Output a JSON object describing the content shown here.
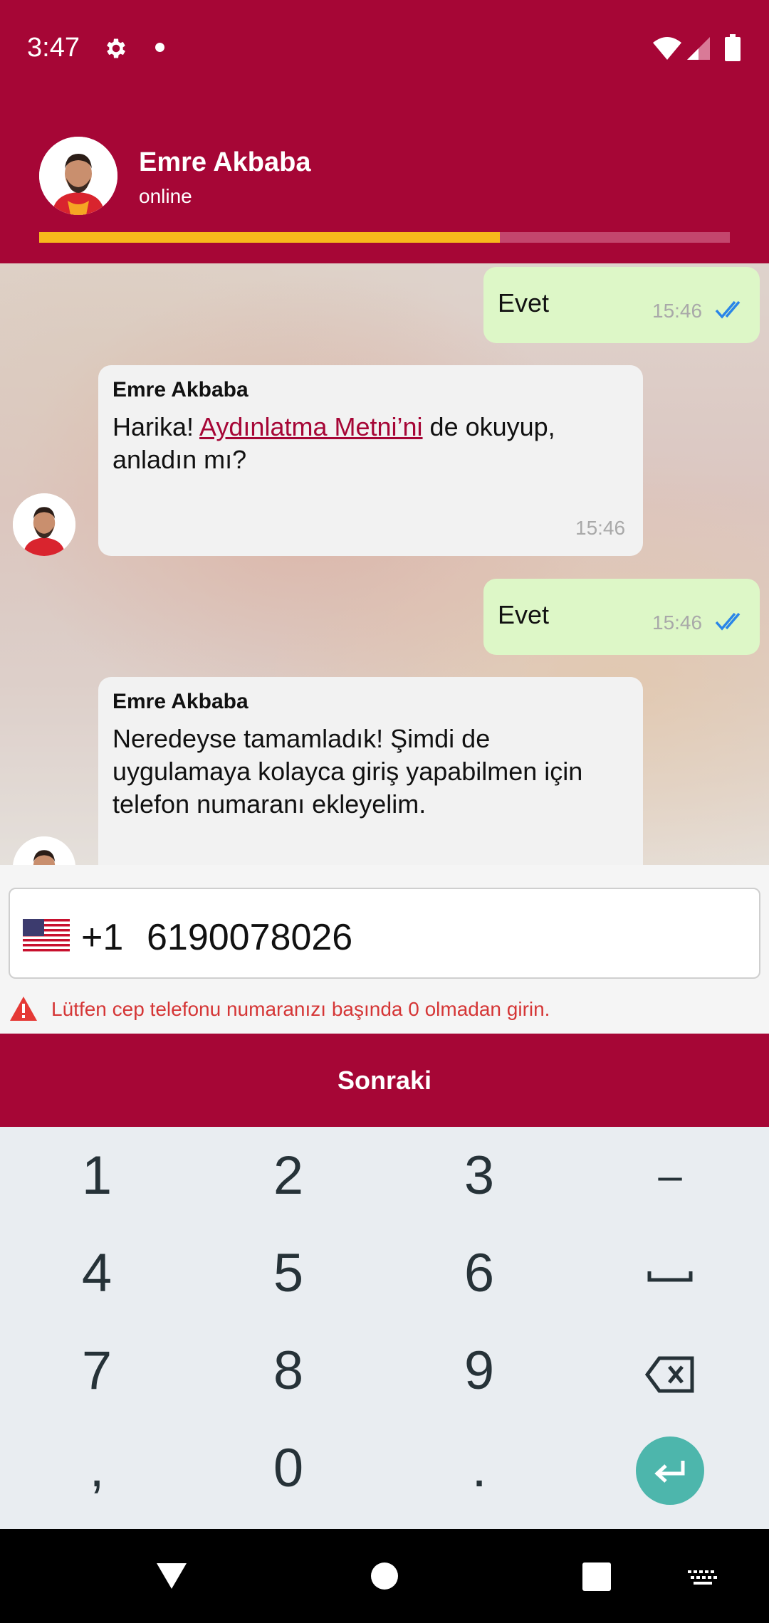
{
  "status_bar": {
    "time": "3:47"
  },
  "header": {
    "name": "Emre Akbaba",
    "status": "online",
    "progress": 0.667
  },
  "chat": {
    "messages": [
      {
        "dir": "out",
        "text": "Evet",
        "time": "15:46"
      },
      {
        "dir": "in",
        "sender": "Emre Akbaba",
        "text_before": "Harika! ",
        "link": "Aydınlatma Metni’ni",
        "text_after": " de okuyup, anladın mı?",
        "time": "15:46"
      },
      {
        "dir": "out",
        "text": "Evet",
        "time": "15:46"
      },
      {
        "dir": "in",
        "sender": "Emre Akbaba",
        "text": "Neredeyse tamamladık! Şimdi de uygulamaya kolayca giriş yapabilmen için telefon numaranı ekleyelim."
      }
    ]
  },
  "phone_input": {
    "country_flag": "us-flag-icon",
    "country_code": "+1",
    "value": "6190078026",
    "warning": "Lütfen cep telefonu numaranızı başında 0 olmadan girin."
  },
  "next_button": "Sonraki",
  "keyboard": {
    "keys": [
      "1",
      "2",
      "3",
      "–",
      "4",
      "5",
      "6",
      "␣",
      "7",
      "8",
      "9",
      "⌫",
      ",",
      "0",
      "."
    ]
  },
  "colors": {
    "brand": "#a60636",
    "accent": "#f8b81c",
    "outgoing": "#ddf7c7",
    "incoming": "#f2f2f2",
    "warning": "#d53636",
    "enter": "#4db6ac"
  }
}
